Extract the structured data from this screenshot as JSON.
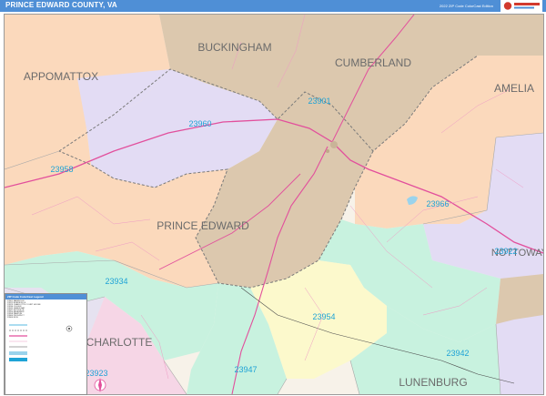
{
  "header": {
    "title": "PRINCE EDWARD COUNTY, VA",
    "edition": "2022 ZIP Code ColorCast Edition",
    "colors": {
      "title_bar": "#4f8fd6",
      "title_text": "#ffffff"
    }
  },
  "map": {
    "counties": {
      "buckingham": "BUCKINGHAM",
      "cumberland": "CUMBERLAND",
      "appomattox": "APPOMATTOX",
      "amelia": "AMELIA",
      "prince_edward": "PRINCE EDWARD",
      "nottoway": "NOTTOWAY",
      "charlotte": "CHARLOTTE",
      "lunenburg": "LUNENBURG"
    },
    "zips": {
      "z23901": "23901",
      "z23960": "23960",
      "z23958": "23958",
      "z23966": "23966",
      "z23922": "23922",
      "z23934": "23934",
      "z23954": "23954",
      "z23942": "23942",
      "z23947": "23947",
      "z23923": "23923"
    },
    "zone_colors": {
      "tan": "#dcc8ae",
      "lavender": "#e3dcf4",
      "peach": "#fbd9bc",
      "mint": "#c8f2df",
      "yellow": "#fcf9cc",
      "pink": "#f6d6e6",
      "grey_lavender": "#e6e2f0"
    },
    "label_colors": {
      "zip": "#1fa3d6",
      "county": "#6b6b6b"
    }
  },
  "legend": {
    "title": "ZIP Code ColorCast Legend",
    "rows": [
      "23901  FARMVILLE",
      "23922  BURKEVILLE",
      "23923  CHARLOTTE COURT HOUSE",
      "23934  CULLEN",
      "23942  GREEN BAY",
      "23947  KEYSVILLE",
      "23954  MEHERRIN",
      "23958  PAMPLIN",
      "23960  PROSPECT",
      "23966  RICE"
    ]
  }
}
